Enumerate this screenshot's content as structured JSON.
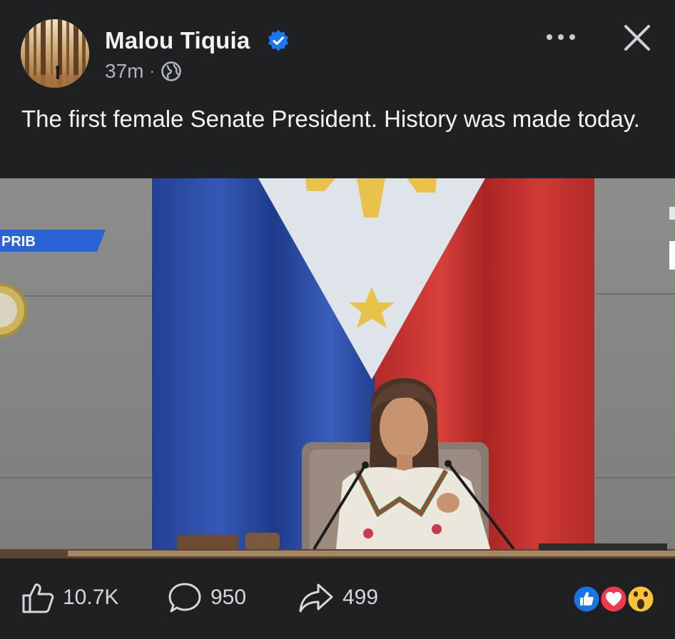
{
  "post": {
    "author": "Malou Tiquia",
    "time": "37m",
    "separator": "·",
    "text": "The first female Senate President. History was made today."
  },
  "media": {
    "banner_text": "PRIB"
  },
  "actions": {
    "likes": "10.7K",
    "comments": "950",
    "shares": "499"
  },
  "colors": {
    "background": "#1f2022",
    "verified": "#1877f2",
    "flag_blue": "#2e50a8",
    "flag_red": "#c8312f",
    "flag_white": "#dfe3ea",
    "sun_yellow": "#e8c24a"
  },
  "icons": {
    "verified": "verified-badge-icon",
    "audience": "globe-icon",
    "more": "more-options-icon",
    "close": "close-icon",
    "like": "thumbs-up-icon",
    "comment": "comment-bubble-icon",
    "share": "share-arrow-icon"
  },
  "reactions": [
    "like",
    "love",
    "wow"
  ]
}
